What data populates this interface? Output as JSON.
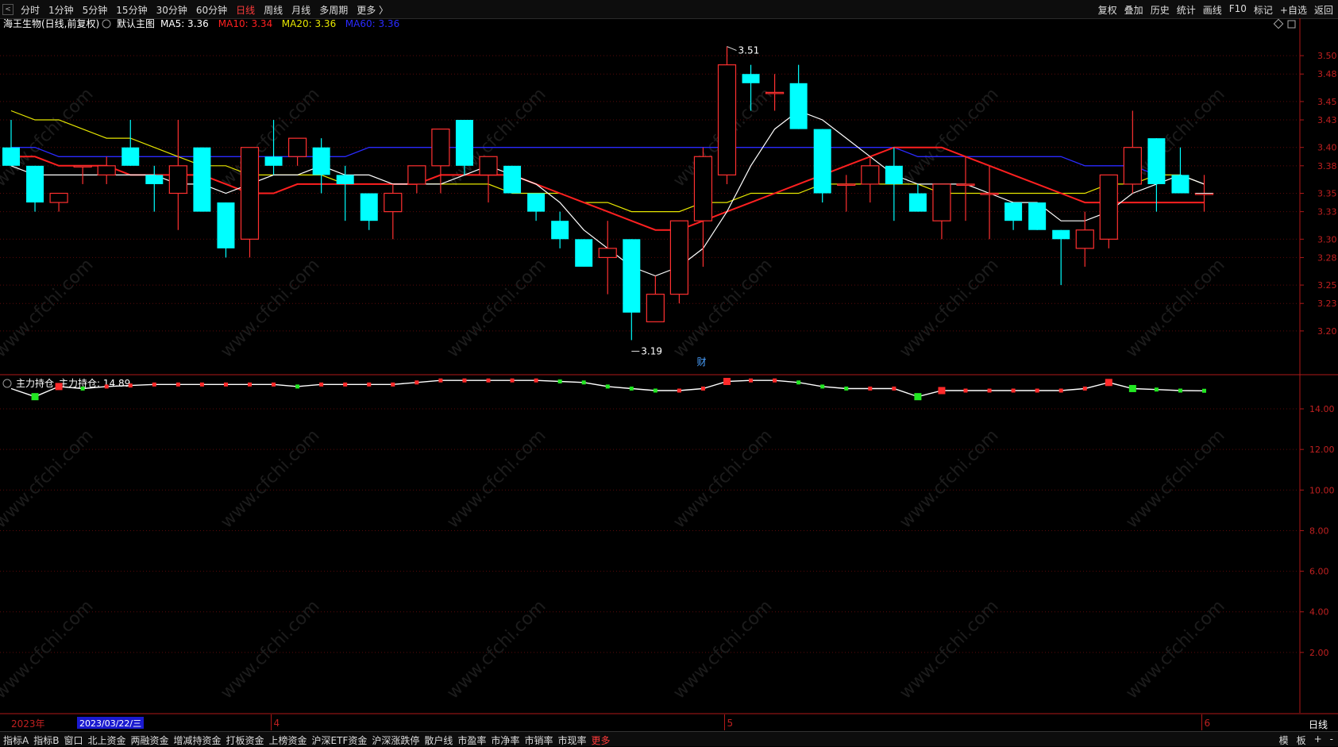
{
  "toolbar": {
    "back_label": "<",
    "periods": [
      "分时",
      "1分钟",
      "5分钟",
      "15分钟",
      "30分钟",
      "60分钟",
      "日线",
      "周线",
      "月线",
      "多周期",
      "更多 〉"
    ],
    "active_period": "日线",
    "tools": [
      "复权",
      "叠加",
      "历史",
      "统计",
      "画线",
      "F10",
      "标记",
      "+自选",
      "返回"
    ]
  },
  "header": {
    "stock": "海王生物(日线,前复权)",
    "chart_name": "默认主图",
    "ma": [
      {
        "label": "MA5: 3.36",
        "color": "#ffffff"
      },
      {
        "label": "MA10: 3.34",
        "color": "#ff2020"
      },
      {
        "label": "MA20: 3.36",
        "color": "#e6e600"
      },
      {
        "label": "MA60: 3.36",
        "color": "#2a2aff"
      }
    ]
  },
  "indicator": {
    "name": "主力持仓",
    "value_label": "主力持仓: 14.89"
  },
  "watermark": "www.cfchi.com",
  "date_axis": {
    "year_label": "2023年",
    "cursor_date": "2023/03/22/三",
    "month_labels": [
      "4",
      "5",
      "6"
    ],
    "period_label": "日线"
  },
  "statusbar": {
    "tabs": [
      "指标A",
      "指标B",
      "窗口",
      "北上资金",
      "两融资金",
      "增减持资金",
      "打板资金",
      "上榜资金",
      "沪深ETF资金",
      "沪深涨跌停",
      "散户线",
      "市盈率",
      "市净率",
      "市销率",
      "市现率",
      "更多"
    ],
    "right": [
      "模",
      "板",
      "+",
      "-"
    ]
  },
  "colors": {
    "up": "#ff3030",
    "down": "#00ffff",
    "ma5": "#ffffff",
    "ma10": "#ff2020",
    "ma20": "#e6e600",
    "ma60": "#2a2aff",
    "axis": "#b01818"
  },
  "chart_data": [
    {
      "type": "candlestick",
      "title": "海王生物(日线,前复权)",
      "y_ticks": [
        3.5,
        3.48,
        3.45,
        3.43,
        3.4,
        3.38,
        3.35,
        3.33,
        3.3,
        3.28,
        3.25,
        3.23,
        3.2
      ],
      "ylim": [
        3.18,
        3.52
      ],
      "annotations": [
        {
          "text": "3.51",
          "at": "high"
        },
        {
          "text": "3.19",
          "at": "low"
        },
        {
          "text": "财",
          "at": "marker"
        }
      ],
      "candles": [
        {
          "o": 3.4,
          "h": 3.43,
          "l": 3.38,
          "c": 3.38
        },
        {
          "o": 3.38,
          "h": 3.38,
          "l": 3.33,
          "c": 3.34
        },
        {
          "o": 3.34,
          "h": 3.35,
          "l": 3.33,
          "c": 3.35
        },
        {
          "o": 3.38,
          "h": 3.38,
          "l": 3.36,
          "c": 3.38
        },
        {
          "o": 3.37,
          "h": 3.39,
          "l": 3.36,
          "c": 3.38
        },
        {
          "o": 3.4,
          "h": 3.43,
          "l": 3.38,
          "c": 3.38
        },
        {
          "o": 3.37,
          "h": 3.38,
          "l": 3.33,
          "c": 3.36
        },
        {
          "o": 3.35,
          "h": 3.43,
          "l": 3.31,
          "c": 3.38
        },
        {
          "o": 3.4,
          "h": 3.4,
          "l": 3.33,
          "c": 3.33
        },
        {
          "o": 3.34,
          "h": 3.34,
          "l": 3.28,
          "c": 3.29
        },
        {
          "o": 3.3,
          "h": 3.4,
          "l": 3.28,
          "c": 3.4
        },
        {
          "o": 3.39,
          "h": 3.43,
          "l": 3.37,
          "c": 3.38
        },
        {
          "o": 3.39,
          "h": 3.41,
          "l": 3.38,
          "c": 3.41
        },
        {
          "o": 3.4,
          "h": 3.41,
          "l": 3.35,
          "c": 3.37
        },
        {
          "o": 3.37,
          "h": 3.38,
          "l": 3.32,
          "c": 3.36
        },
        {
          "o": 3.35,
          "h": 3.35,
          "l": 3.31,
          "c": 3.32
        },
        {
          "o": 3.33,
          "h": 3.36,
          "l": 3.3,
          "c": 3.35
        },
        {
          "o": 3.36,
          "h": 3.38,
          "l": 3.35,
          "c": 3.38
        },
        {
          "o": 3.38,
          "h": 3.42,
          "l": 3.35,
          "c": 3.42
        },
        {
          "o": 3.43,
          "h": 3.43,
          "l": 3.37,
          "c": 3.38
        },
        {
          "o": 3.37,
          "h": 3.39,
          "l": 3.34,
          "c": 3.39
        },
        {
          "o": 3.38,
          "h": 3.38,
          "l": 3.35,
          "c": 3.35
        },
        {
          "o": 3.35,
          "h": 3.35,
          "l": 3.32,
          "c": 3.33
        },
        {
          "o": 3.32,
          "h": 3.33,
          "l": 3.29,
          "c": 3.3
        },
        {
          "o": 3.3,
          "h": 3.3,
          "l": 3.27,
          "c": 3.27
        },
        {
          "o": 3.28,
          "h": 3.32,
          "l": 3.24,
          "c": 3.29
        },
        {
          "o": 3.3,
          "h": 3.3,
          "l": 3.19,
          "c": 3.22
        },
        {
          "o": 3.21,
          "h": 3.26,
          "l": 3.21,
          "c": 3.24
        },
        {
          "o": 3.24,
          "h": 3.32,
          "l": 3.23,
          "c": 3.32
        },
        {
          "o": 3.32,
          "h": 3.4,
          "l": 3.27,
          "c": 3.39
        },
        {
          "o": 3.37,
          "h": 3.51,
          "l": 3.36,
          "c": 3.49
        },
        {
          "o": 3.48,
          "h": 3.49,
          "l": 3.44,
          "c": 3.47
        },
        {
          "o": 3.46,
          "h": 3.48,
          "l": 3.44,
          "c": 3.46
        },
        {
          "o": 3.47,
          "h": 3.49,
          "l": 3.42,
          "c": 3.42
        },
        {
          "o": 3.42,
          "h": 3.42,
          "l": 3.34,
          "c": 3.35
        },
        {
          "o": 3.36,
          "h": 3.37,
          "l": 3.33,
          "c": 3.36
        },
        {
          "o": 3.36,
          "h": 3.39,
          "l": 3.34,
          "c": 3.38
        },
        {
          "o": 3.38,
          "h": 3.4,
          "l": 3.32,
          "c": 3.36
        },
        {
          "o": 3.35,
          "h": 3.36,
          "l": 3.33,
          "c": 3.33
        },
        {
          "o": 3.32,
          "h": 3.36,
          "l": 3.3,
          "c": 3.36
        },
        {
          "o": 3.36,
          "h": 3.39,
          "l": 3.32,
          "c": 3.36
        },
        {
          "o": 3.35,
          "h": 3.38,
          "l": 3.3,
          "c": 3.35
        },
        {
          "o": 3.34,
          "h": 3.34,
          "l": 3.31,
          "c": 3.32
        },
        {
          "o": 3.34,
          "h": 3.34,
          "l": 3.31,
          "c": 3.31
        },
        {
          "o": 3.31,
          "h": 3.31,
          "l": 3.25,
          "c": 3.3
        },
        {
          "o": 3.29,
          "h": 3.33,
          "l": 3.27,
          "c": 3.31
        },
        {
          "o": 3.3,
          "h": 3.37,
          "l": 3.29,
          "c": 3.37
        },
        {
          "o": 3.36,
          "h": 3.44,
          "l": 3.35,
          "c": 3.4
        },
        {
          "o": 3.41,
          "h": 3.41,
          "l": 3.33,
          "c": 3.36
        },
        {
          "o": 3.37,
          "h": 3.4,
          "l": 3.35,
          "c": 3.35
        },
        {
          "o": 3.35,
          "h": 3.37,
          "l": 3.33,
          "c": 3.35
        }
      ],
      "ma5": [
        3.38,
        3.37,
        3.37,
        3.37,
        3.37,
        3.37,
        3.37,
        3.36,
        3.36,
        3.35,
        3.36,
        3.37,
        3.37,
        3.38,
        3.37,
        3.37,
        3.36,
        3.36,
        3.36,
        3.37,
        3.38,
        3.37,
        3.36,
        3.34,
        3.31,
        3.29,
        3.27,
        3.26,
        3.27,
        3.29,
        3.33,
        3.38,
        3.42,
        3.44,
        3.43,
        3.41,
        3.39,
        3.37,
        3.36,
        3.36,
        3.36,
        3.35,
        3.34,
        3.34,
        3.32,
        3.32,
        3.33,
        3.35,
        3.36,
        3.37,
        3.36
      ],
      "ma10": [
        3.39,
        3.39,
        3.38,
        3.38,
        3.38,
        3.37,
        3.37,
        3.37,
        3.37,
        3.36,
        3.35,
        3.35,
        3.36,
        3.36,
        3.36,
        3.36,
        3.36,
        3.36,
        3.37,
        3.37,
        3.37,
        3.37,
        3.36,
        3.35,
        3.34,
        3.33,
        3.32,
        3.31,
        3.31,
        3.32,
        3.33,
        3.34,
        3.35,
        3.36,
        3.37,
        3.38,
        3.39,
        3.4,
        3.4,
        3.4,
        3.39,
        3.38,
        3.37,
        3.36,
        3.35,
        3.34,
        3.34,
        3.34,
        3.34,
        3.34,
        3.34
      ],
      "ma20": [
        3.44,
        3.43,
        3.43,
        3.42,
        3.41,
        3.41,
        3.4,
        3.39,
        3.38,
        3.38,
        3.37,
        3.37,
        3.37,
        3.37,
        3.36,
        3.36,
        3.36,
        3.36,
        3.36,
        3.36,
        3.36,
        3.35,
        3.35,
        3.35,
        3.34,
        3.34,
        3.33,
        3.33,
        3.33,
        3.34,
        3.34,
        3.35,
        3.35,
        3.35,
        3.36,
        3.36,
        3.36,
        3.36,
        3.36,
        3.35,
        3.35,
        3.35,
        3.35,
        3.35,
        3.35,
        3.35,
        3.36,
        3.36,
        3.37,
        3.37,
        3.36
      ],
      "ma60": [
        3.4,
        3.4,
        3.39,
        3.39,
        3.39,
        3.39,
        3.39,
        3.39,
        3.39,
        3.39,
        3.39,
        3.39,
        3.39,
        3.39,
        3.39,
        3.4,
        3.4,
        3.4,
        3.4,
        3.4,
        3.4,
        3.4,
        3.4,
        3.4,
        3.4,
        3.4,
        3.4,
        3.4,
        3.4,
        3.4,
        3.4,
        3.4,
        3.4,
        3.4,
        3.4,
        3.4,
        3.4,
        3.4,
        3.39,
        3.39,
        3.39,
        3.39,
        3.39,
        3.39,
        3.39,
        3.38,
        3.38,
        3.38,
        3.37,
        3.37,
        3.36
      ]
    },
    {
      "type": "line",
      "title": "主力持仓",
      "y_ticks": [
        14.0,
        12.0,
        10.0,
        8.0,
        6.0,
        4.0,
        2.0
      ],
      "ylim": [
        0,
        15.8
      ],
      "values": [
        15.0,
        14.6,
        15.1,
        15.0,
        15.1,
        15.15,
        15.2,
        15.2,
        15.2,
        15.2,
        15.2,
        15.2,
        15.1,
        15.2,
        15.2,
        15.2,
        15.2,
        15.3,
        15.4,
        15.4,
        15.4,
        15.4,
        15.4,
        15.35,
        15.3,
        15.1,
        15.0,
        14.9,
        14.9,
        15.0,
        15.35,
        15.4,
        15.4,
        15.3,
        15.1,
        15.0,
        15.0,
        15.0,
        14.6,
        14.9,
        14.9,
        14.9,
        14.9,
        14.9,
        14.9,
        15.0,
        15.3,
        15.0,
        14.95,
        14.9,
        14.89
      ]
    }
  ]
}
